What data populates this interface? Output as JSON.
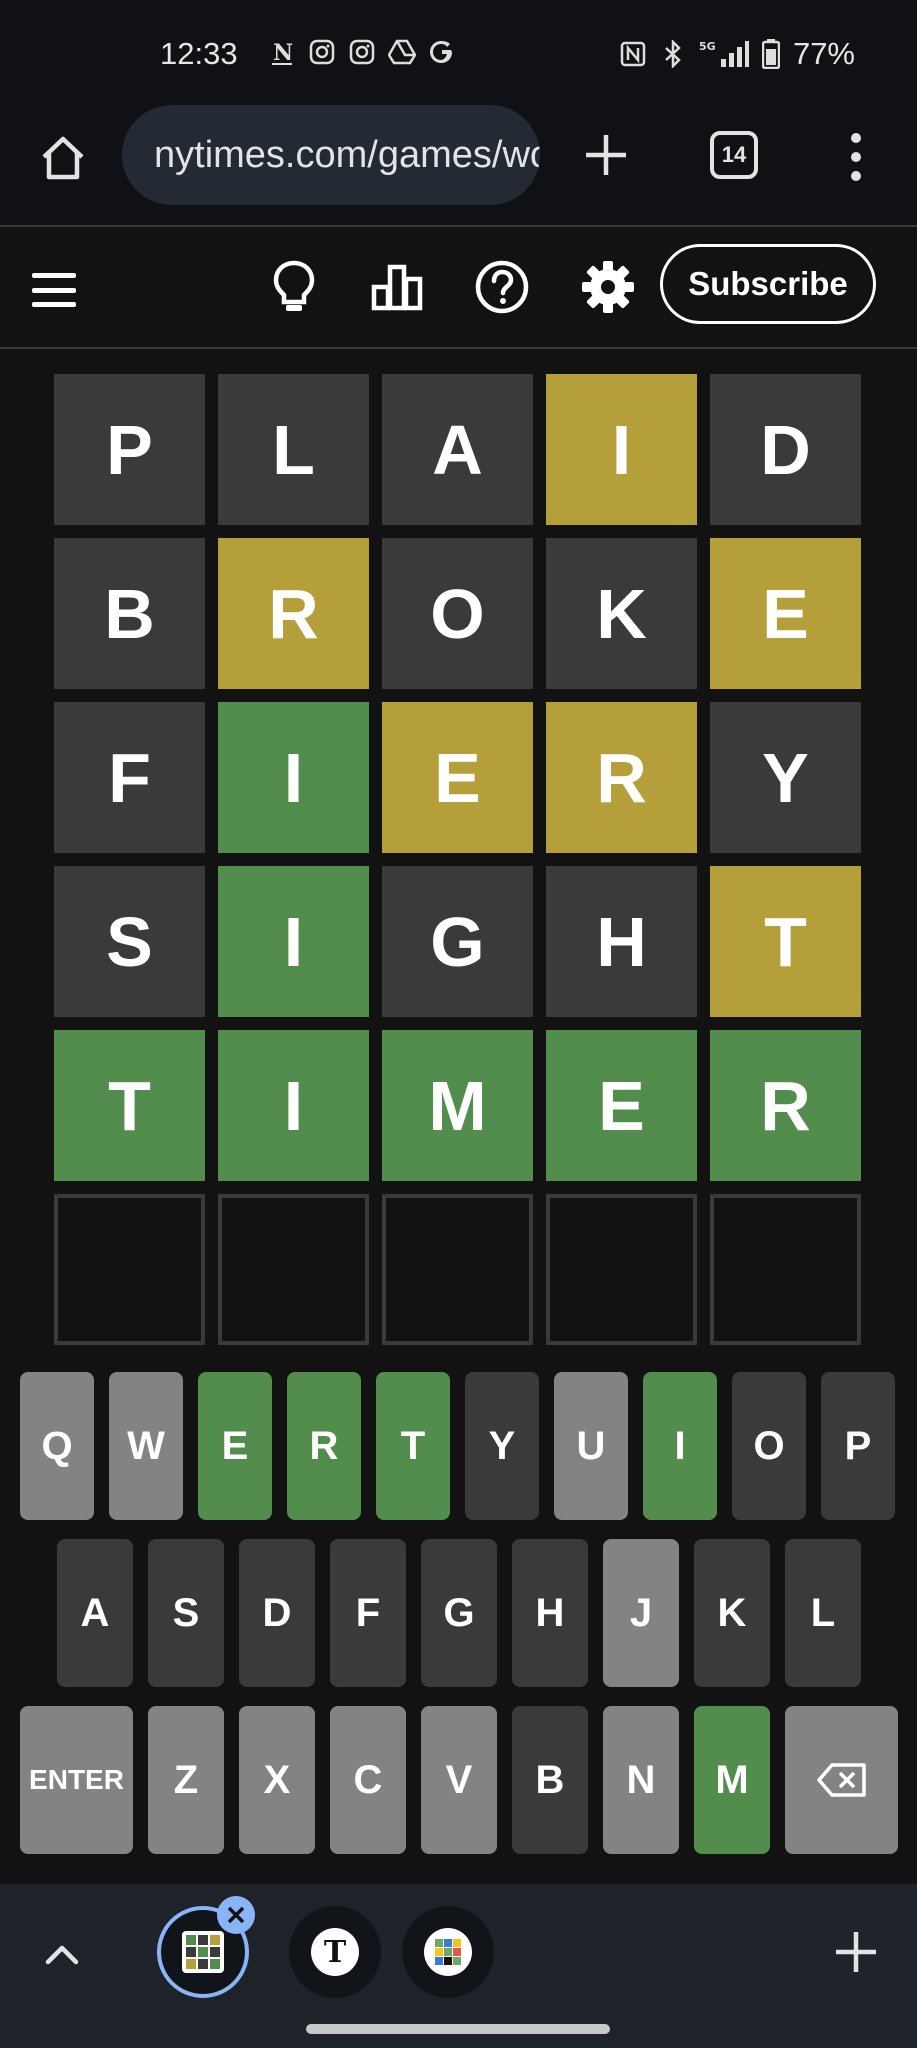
{
  "status_bar": {
    "time": "12:33",
    "battery": "77%",
    "network": "5G",
    "left_icons": [
      "nytimes-notification-icon",
      "instagram-icon",
      "instagram-icon",
      "drive-icon",
      "google-icon"
    ],
    "right_icons": [
      "nfc-icon",
      "bluetooth-icon",
      "signal-5g-icon",
      "battery-icon"
    ]
  },
  "browser": {
    "url": "nytimes.com/games/wordle",
    "tab_count": "14"
  },
  "game_header": {
    "subscribe_label": "Subscribe",
    "icons": [
      "hint-lightbulb-icon",
      "stats-bar-chart-icon",
      "help-question-icon",
      "settings-gear-icon"
    ]
  },
  "board": {
    "rows": [
      [
        {
          "l": "P",
          "s": "absent"
        },
        {
          "l": "L",
          "s": "absent"
        },
        {
          "l": "A",
          "s": "absent"
        },
        {
          "l": "I",
          "s": "present"
        },
        {
          "l": "D",
          "s": "absent"
        }
      ],
      [
        {
          "l": "B",
          "s": "absent"
        },
        {
          "l": "R",
          "s": "present"
        },
        {
          "l": "O",
          "s": "absent"
        },
        {
          "l": "K",
          "s": "absent"
        },
        {
          "l": "E",
          "s": "present"
        }
      ],
      [
        {
          "l": "F",
          "s": "absent"
        },
        {
          "l": "I",
          "s": "correct"
        },
        {
          "l": "E",
          "s": "present"
        },
        {
          "l": "R",
          "s": "present"
        },
        {
          "l": "Y",
          "s": "absent"
        }
      ],
      [
        {
          "l": "S",
          "s": "absent"
        },
        {
          "l": "I",
          "s": "correct"
        },
        {
          "l": "G",
          "s": "absent"
        },
        {
          "l": "H",
          "s": "absent"
        },
        {
          "l": "T",
          "s": "present"
        }
      ],
      [
        {
          "l": "T",
          "s": "correct"
        },
        {
          "l": "I",
          "s": "correct"
        },
        {
          "l": "M",
          "s": "correct"
        },
        {
          "l": "E",
          "s": "correct"
        },
        {
          "l": "R",
          "s": "correct"
        }
      ],
      [
        {
          "l": "",
          "s": "empty"
        },
        {
          "l": "",
          "s": "empty"
        },
        {
          "l": "",
          "s": "empty"
        },
        {
          "l": "",
          "s": "empty"
        },
        {
          "l": "",
          "s": "empty"
        }
      ]
    ]
  },
  "keyboard": {
    "rows": [
      [
        {
          "k": "Q",
          "s": "unused"
        },
        {
          "k": "W",
          "s": "unused"
        },
        {
          "k": "E",
          "s": "correct"
        },
        {
          "k": "R",
          "s": "correct"
        },
        {
          "k": "T",
          "s": "correct"
        },
        {
          "k": "Y",
          "s": "absent"
        },
        {
          "k": "U",
          "s": "unused"
        },
        {
          "k": "I",
          "s": "correct"
        },
        {
          "k": "O",
          "s": "absent"
        },
        {
          "k": "P",
          "s": "absent"
        }
      ],
      [
        {
          "k": "A",
          "s": "absent"
        },
        {
          "k": "S",
          "s": "absent"
        },
        {
          "k": "D",
          "s": "absent"
        },
        {
          "k": "F",
          "s": "absent"
        },
        {
          "k": "G",
          "s": "absent"
        },
        {
          "k": "H",
          "s": "absent"
        },
        {
          "k": "J",
          "s": "unused"
        },
        {
          "k": "K",
          "s": "absent"
        },
        {
          "k": "L",
          "s": "absent"
        }
      ],
      [
        {
          "k": "ENTER",
          "s": "unused"
        },
        {
          "k": "Z",
          "s": "unused"
        },
        {
          "k": "X",
          "s": "unused"
        },
        {
          "k": "C",
          "s": "unused"
        },
        {
          "k": "V",
          "s": "unused"
        },
        {
          "k": "B",
          "s": "absent"
        },
        {
          "k": "N",
          "s": "unused"
        },
        {
          "k": "M",
          "s": "correct"
        },
        {
          "k": "⌫",
          "s": "unused"
        }
      ]
    ]
  },
  "tab_strip": {
    "tabs": [
      {
        "name": "wordle-tab",
        "active": true
      },
      {
        "name": "nytimes-tab",
        "active": false
      },
      {
        "name": "nyt-games-tab",
        "active": false
      }
    ]
  },
  "colors": {
    "absent": "#3a3a3c",
    "present": "#b59f3b",
    "correct": "#538d4e",
    "unused_key": "#818384",
    "background": "#121213"
  }
}
